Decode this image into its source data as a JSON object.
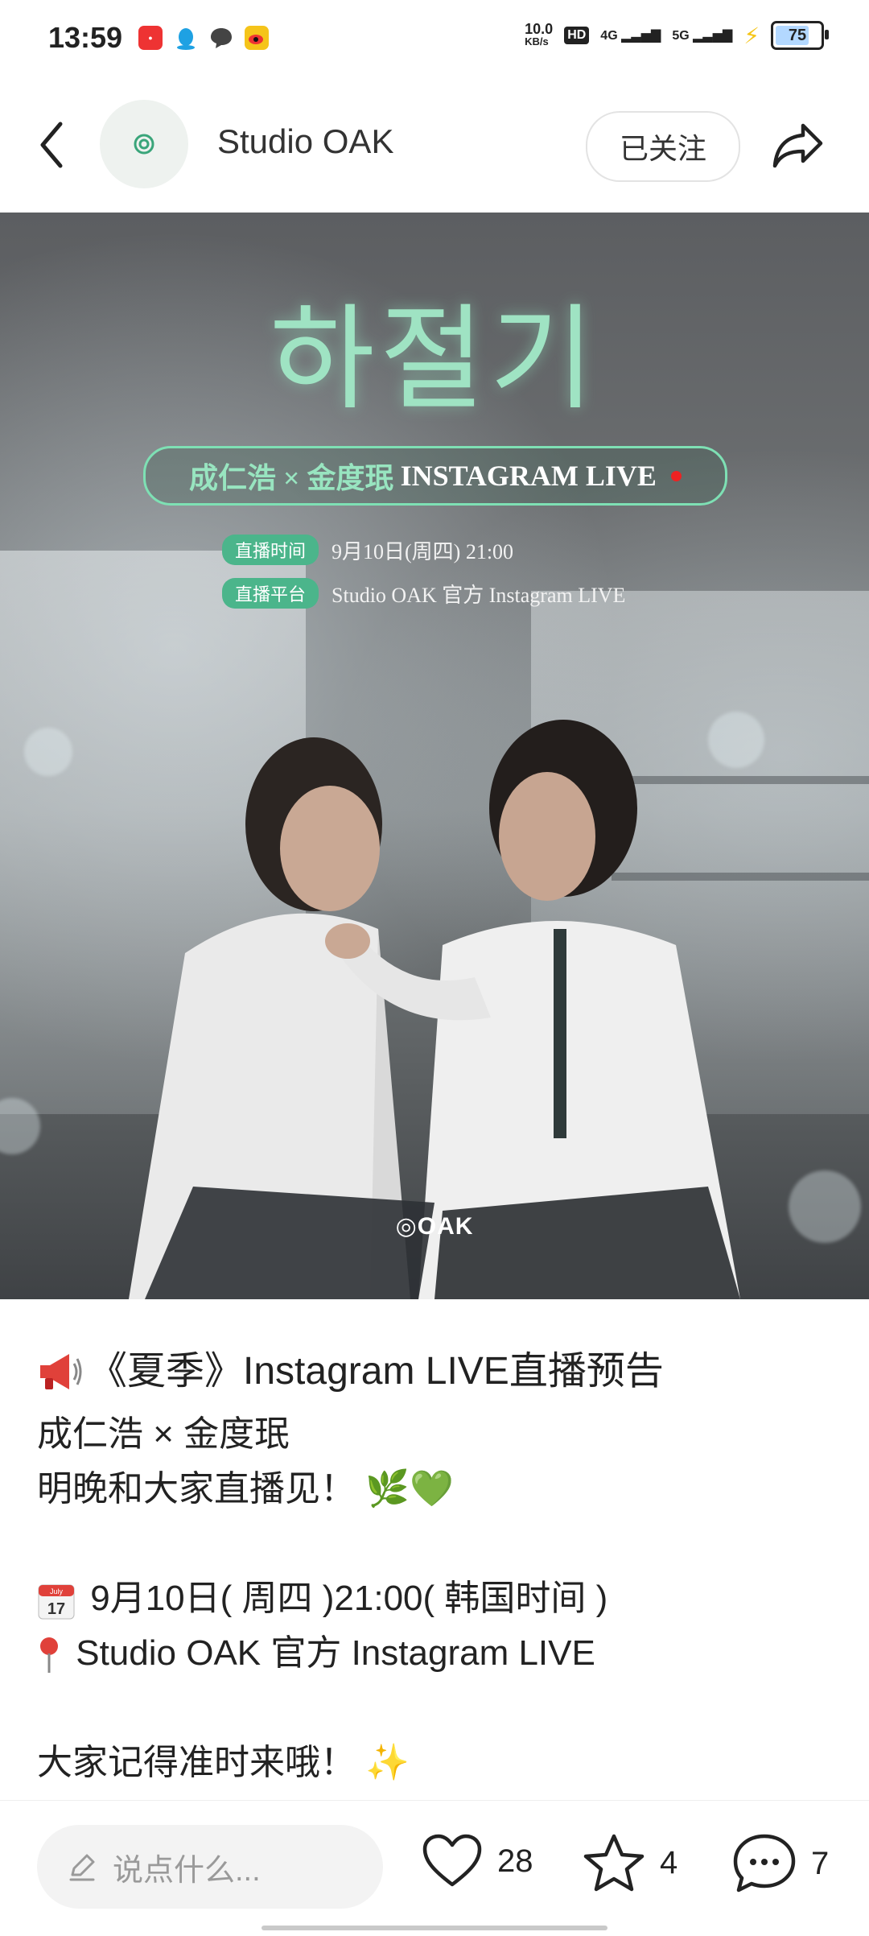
{
  "status_bar": {
    "time": "13:59",
    "net_speed_value": "10.0",
    "net_speed_unit": "KB/s",
    "hd_label": "HD",
    "signal_1": "4G",
    "signal_2": "5G",
    "battery": "75",
    "battery_level": 0.75
  },
  "header": {
    "account_name": "Studio OAK",
    "follow_label": "已关注"
  },
  "poster": {
    "korean_title": "하절기",
    "live_cast": "成仁浩 × 金度珉",
    "live_label": "INSTAGRAM LIVE",
    "time_tag": "直播时间",
    "time_value": "9月10日(周四) 21:00",
    "platform_tag": "直播平台",
    "platform_value": "Studio OAK 官方 Instagram LIVE",
    "logo_text": "OAK"
  },
  "post": {
    "title": "《夏季》Instagram LIVE直播预告",
    "line1": "成仁浩 × 金度珉",
    "line2": "明晚和大家直播见！",
    "line3": "9月10日( 周四 )21:00( 韩国时间 )",
    "line4": "Studio OAK 官方 Instagram LIVE",
    "line5": "大家记得准时来哦！",
    "calendar_month": "July",
    "calendar_day": "17"
  },
  "bottom_bar": {
    "comment_placeholder": "说点什么...",
    "like_count": "28",
    "favorite_count": "4",
    "comment_count": "7"
  },
  "colors": {
    "accent_green": "#4bb58b",
    "title_green": "#9fe3c3",
    "live_dot": "#e22222"
  }
}
